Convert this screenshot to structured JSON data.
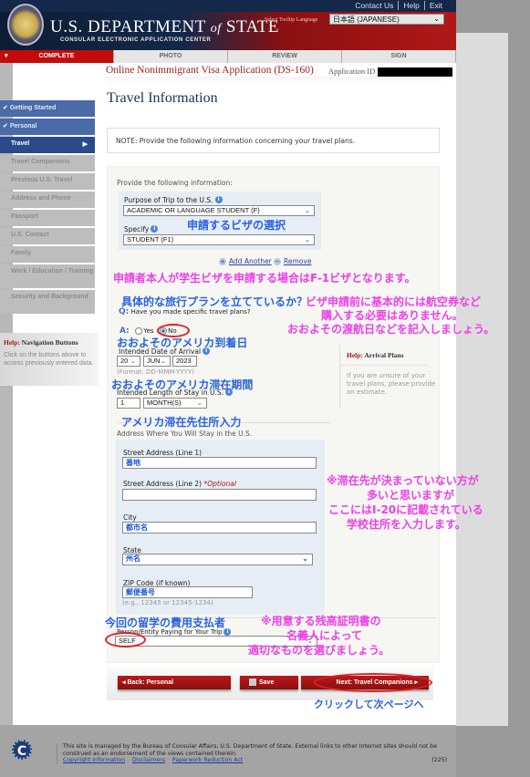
{
  "header": {
    "top_links": [
      "Contact Us",
      "Help",
      "Exit"
    ],
    "brand_main": "U.S. DEPARTMENT",
    "brand_of": "of",
    "brand_state": "STATE",
    "brand_sub": "CONSULAR ELECTRONIC APPLICATION CENTER",
    "tooltip_label": "Select Tooltip Language",
    "tooltip_value": "日本語 (JAPANESE)"
  },
  "nav_tabs": [
    "COMPLETE",
    "PHOTO",
    "REVIEW",
    "SIGN"
  ],
  "app": {
    "title": "Online Nonimmigrant Visa Application (DS-160)",
    "id_label": "Application ID"
  },
  "sidebar": {
    "items": [
      {
        "label": "Getting Started",
        "state": "done"
      },
      {
        "label": "Personal",
        "state": "done"
      },
      {
        "label": "Travel",
        "state": "current"
      },
      {
        "label": "Travel Companions",
        "state": "todo"
      },
      {
        "label": "Previous U.S. Travel",
        "state": "todo"
      },
      {
        "label": "Address and Phone",
        "state": "todo"
      },
      {
        "label": "Passport",
        "state": "todo"
      },
      {
        "label": "U.S. Contact",
        "state": "todo"
      },
      {
        "label": "Family",
        "state": "todo"
      },
      {
        "label": "Work / Education / Training",
        "state": "todo"
      },
      {
        "label": "Security and Background",
        "state": "todo"
      }
    ],
    "help_prefix": "Help:",
    "help_title": "Navigation Buttons",
    "help_body": "Click on the buttons above to access previously entered data."
  },
  "page": {
    "title": "Travel Information",
    "note": "NOTE: Provide the following information concerning your travel plans.",
    "provide": "Provide the following information:",
    "purpose_label": "Purpose of Trip to the U.S.",
    "purpose_value": "ACADEMIC OR LANGUAGE STUDENT (F)",
    "specify_label": "Specify",
    "specify_value": "STUDENT (F1)",
    "add_another": "Add Another",
    "remove": "Remove",
    "question_prefix": "Q:",
    "question": "Have you made specific travel plans?",
    "answer_prefix": "A:",
    "yes": "Yes",
    "no": "No",
    "selected_answer": "No",
    "arrival_label": "Intended Date of Arrival",
    "arrival_day": "20",
    "arrival_month": "JUN",
    "arrival_year": "2023",
    "arrival_format": "(Format: DD-MMM-YYYY)",
    "stay_label": "Intended Length of Stay in U.S.",
    "stay_value": "1",
    "stay_unit": "MONTH(S)",
    "address_heading": "Address Where You Will Stay in the U.S.",
    "street1_label": "Street Address (Line 1)",
    "street1_value": "番地",
    "street2_label": "Street Address (Line 2)",
    "optional": "*Optional",
    "street2_value": "",
    "city_label": "City",
    "city_value": "都市名",
    "state_label": "State",
    "state_value": "州名",
    "zip_label": "ZIP Code (if known)",
    "zip_value": "郵便番号",
    "zip_hint": "(e.g., 12345 or 12345-1234)",
    "payer_label": "Person/Entity Paying for Your Trip",
    "payer_value": "SELF"
  },
  "help_arrival": {
    "prefix": "Help:",
    "title": "Arrival Plans",
    "body": "If you are unsure of your travel plans, please provide an estimate."
  },
  "buttons": {
    "back": "◂ Back: Personal",
    "save": "Save",
    "next": "Next: Travel Companions ▸"
  },
  "annotations": {
    "visa_select": "申請するビザの選択",
    "f1_note": "申請者本人が学生ビザを申請する場合はF-1ビザとなります。",
    "plan_q": "具体的な旅行プランを立てているか？",
    "plan_note1": "ビザ申請前に基本的には航空券など",
    "plan_note2": "購入する必要はありません。",
    "plan_note3": "おおよその渡航日などを記入しましょう。",
    "arrival": "おおよそのアメリカ到着日",
    "stay": "おおよそのアメリカ滞在期間",
    "address": "アメリカ滞在先住所入力",
    "addr_note1": "※滞在先が決まっていない方が",
    "addr_note2": "多いと思いますが",
    "addr_note3": "ここにはI-20に記載されている",
    "addr_note4": "学校住所を入力します。",
    "payer": "今回の留学の費用支払者",
    "payer_note1": "※用意する残高証明書の",
    "payer_note2": "名義人によって",
    "payer_note3": "適切なものを選びましょう。",
    "next_note": "クリックして次ページへ"
  },
  "footer": {
    "text": "This site is managed by the Bureau of Consular Affairs, U.S. Department of State. External links to other Internet sites should not be construed as an endorsement of the views contained therein.",
    "links": [
      "Copyright Information",
      "Disclaimers",
      "Paperwork Reduction Act"
    ],
    "count": "(225)"
  }
}
